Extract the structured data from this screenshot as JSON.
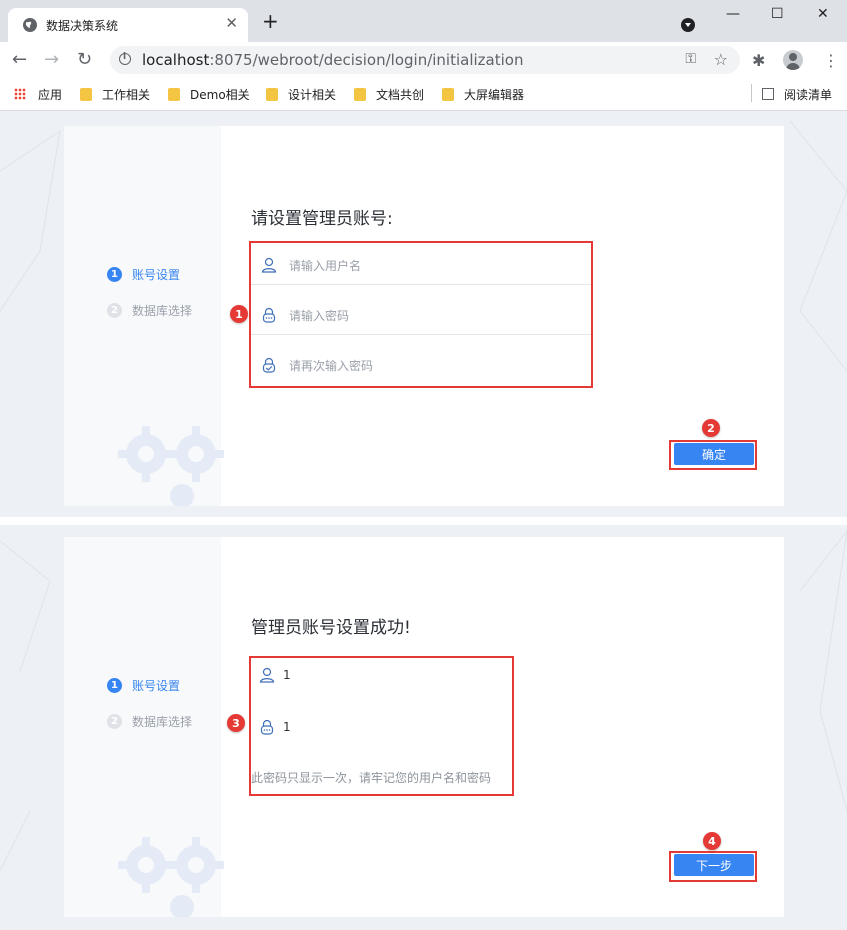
{
  "browser": {
    "tab_title": "数据决策系统",
    "tab_close": "✕",
    "new_tab": "+",
    "url_host": "localhost",
    "url_rest": ":8075/webroot/decision/login/initialization",
    "back": "←",
    "forward": "→",
    "reload": "↻",
    "key_icon": "⚿",
    "star_icon": "☆",
    "ext_icon": "✱",
    "menu_icon": "⋮",
    "minimize": "—",
    "maximize": "☐",
    "close": "✕"
  },
  "bookmarks": {
    "apps": "应用",
    "items": [
      "工作相关",
      "Demo相关",
      "设计相关",
      "文档共创",
      "大屏编辑器"
    ],
    "reading_list": "阅读清单"
  },
  "panel1": {
    "steps": [
      {
        "num": "1",
        "label": "账号设置"
      },
      {
        "num": "2",
        "label": "数据库选择"
      }
    ],
    "heading": "请设置管理员账号:",
    "username_placeholder": "请输入用户名",
    "password_placeholder": "请输入密码",
    "confirm_placeholder": "请再次输入密码",
    "confirm_button": "确定",
    "marker_fields": "1",
    "marker_button": "2"
  },
  "panel2": {
    "steps": [
      {
        "num": "1",
        "label": "账号设置"
      },
      {
        "num": "2",
        "label": "数据库选择"
      }
    ],
    "heading": "管理员账号设置成功!",
    "username_value": "1",
    "password_value": "1",
    "tip": "此密码只显示一次，请牢记您的用户名和密码",
    "next_button": "下一步",
    "marker_info": "3",
    "marker_button": "4"
  },
  "colors": {
    "accent": "#3685f2",
    "highlight": "#e53935"
  }
}
